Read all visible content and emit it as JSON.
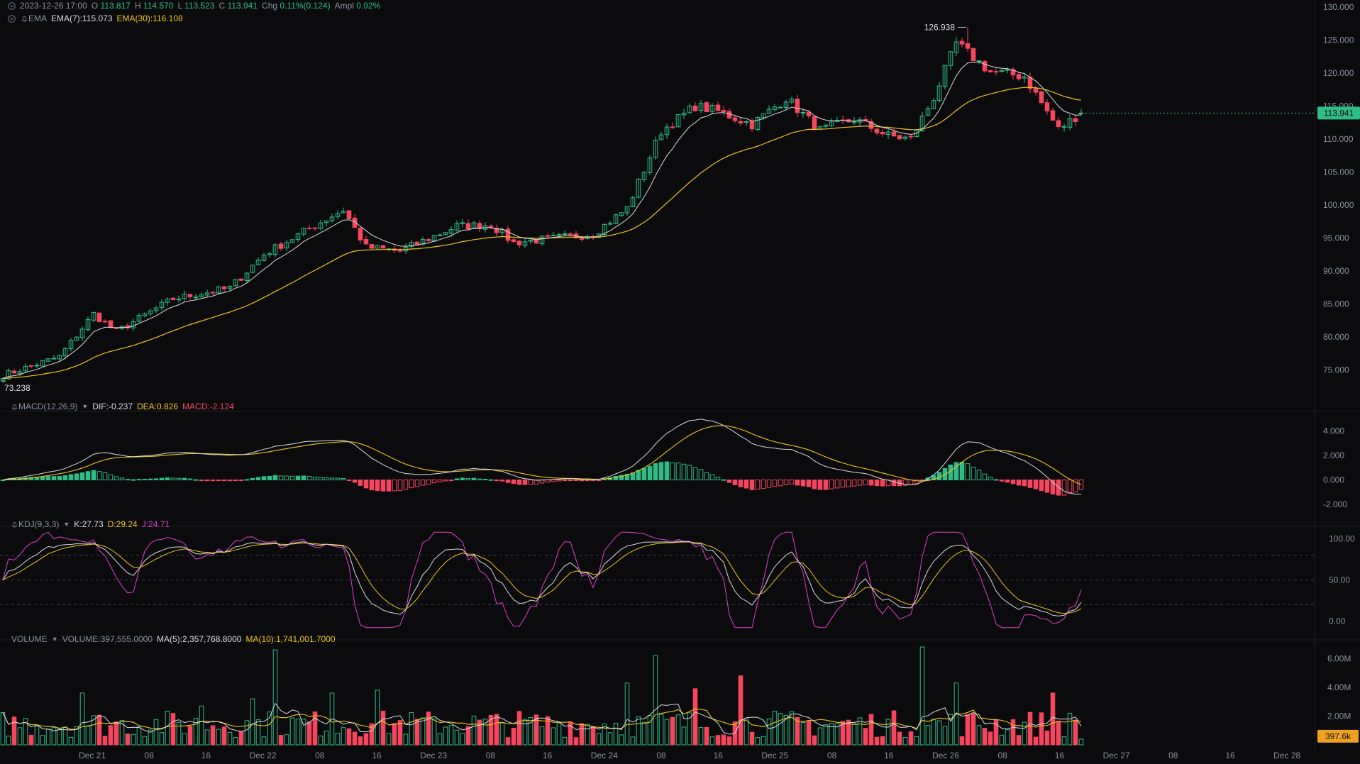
{
  "header": {
    "datetime": "2023-12-26 17:00",
    "open_label": "O",
    "open": "113.817",
    "high_label": "H",
    "high": "114.570",
    "low_label": "L",
    "low": "113.523",
    "close_label": "C",
    "close": "113.941",
    "chg_label": "Chg",
    "chg": "0.11%(0.124)",
    "ampl_label": "Ampl",
    "ampl": "0.92%"
  },
  "ema_legend": {
    "name": "EMA",
    "ema7": "EMA(7):115.073",
    "ema30": "EMA(30):116.108"
  },
  "macd_legend": {
    "name": "MACD(12,26,9)",
    "dif": "DIF:-0.237",
    "dea": "DEA:0.826",
    "macd": "MACD:-2.124"
  },
  "kdj_legend": {
    "name": "KDJ(9,3,3)",
    "k": "K:27.73",
    "d": "D:29.24",
    "j": "J:24.71"
  },
  "volume_legend": {
    "name": "VOLUME",
    "volume": "VOLUME:397,555.0000",
    "ma5": "MA(5):2,357,768.8000",
    "ma10": "MA(10):1,741,001.7000"
  },
  "colors": {
    "up": "#2ebd85",
    "down": "#f6465d",
    "ema7": "#d7dbe0",
    "ema30": "#f0c419",
    "dea": "#f0c419",
    "dif": "#d7dbe0",
    "k": "#d7dbe0",
    "d": "#f0c419",
    "j": "#e040c8",
    "grid": "#1c1f26",
    "axis_text": "#8a919c",
    "background": "#0b0b0e"
  },
  "chart_data": {
    "type": "candlestick",
    "x_axis_labels": [
      "Dec 21",
      "08",
      "16",
      "Dec 22",
      "08",
      "16",
      "Dec 23",
      "08",
      "16",
      "Dec 24",
      "08",
      "16",
      "Dec 25",
      "08",
      "16",
      "Dec 26",
      "08",
      "16",
      "Dec 27",
      "08",
      "16",
      "Dec 28"
    ],
    "price_axis": {
      "ticks": [
        "130.000",
        "125.000",
        "120.000",
        "115.000",
        "110.000",
        "105.000",
        "100.000",
        "95.000",
        "90.000",
        "85.000",
        "80.000",
        "75.000"
      ],
      "range": [
        70,
        130
      ],
      "last_price": "113.941",
      "high_marker": "126.938",
      "low_marker": "73.238"
    },
    "close_anchors": [
      [
        0,
        74.2
      ],
      [
        10,
        77.0
      ],
      [
        16,
        83.5
      ],
      [
        20,
        80.8
      ],
      [
        30,
        85.8
      ],
      [
        40,
        87.4
      ],
      [
        46,
        92.5
      ],
      [
        56,
        97.4
      ],
      [
        60,
        99.3
      ],
      [
        64,
        93.6
      ],
      [
        70,
        93.0
      ],
      [
        80,
        96.8
      ],
      [
        86,
        97.0
      ],
      [
        90,
        94.3
      ],
      [
        104,
        95.6
      ],
      [
        110,
        99.5
      ],
      [
        116,
        111.2
      ],
      [
        122,
        115.0
      ],
      [
        126,
        114.2
      ],
      [
        132,
        112.2
      ],
      [
        138,
        116.2
      ],
      [
        144,
        111.3
      ],
      [
        150,
        113.0
      ],
      [
        156,
        110.5
      ],
      [
        160,
        110.0
      ],
      [
        164,
        116.3
      ],
      [
        168,
        124.5
      ],
      [
        174,
        120.2
      ],
      [
        180,
        119.5
      ],
      [
        186,
        111.5
      ],
      [
        190,
        113.941
      ]
    ],
    "macd_axis": {
      "ticks": [
        "4.000",
        "2.000",
        "0.000",
        "-2.000"
      ],
      "range": [
        -2.8,
        5
      ]
    },
    "kdj_axis": {
      "ticks": [
        "100.00",
        "50.00",
        "0.00"
      ],
      "range": [
        -10,
        110
      ],
      "levels": [
        80,
        50,
        20
      ]
    },
    "volume_axis": {
      "ticks": [
        "6.00M",
        "4.00M",
        "2.00M"
      ],
      "range": [
        0,
        7.0
      ],
      "last_volume": "397.6k"
    },
    "volume_spikes": [
      [
        14,
        3.6
      ],
      [
        35,
        2.7
      ],
      [
        44,
        3.2
      ],
      [
        48,
        6.6
      ],
      [
        58,
        3.6
      ],
      [
        66,
        3.8
      ],
      [
        110,
        4.3
      ],
      [
        115,
        6.2
      ],
      [
        122,
        3.9
      ],
      [
        130,
        4.8
      ],
      [
        162,
        6.8
      ],
      [
        168,
        4.3
      ],
      [
        185,
        3.6
      ]
    ]
  }
}
